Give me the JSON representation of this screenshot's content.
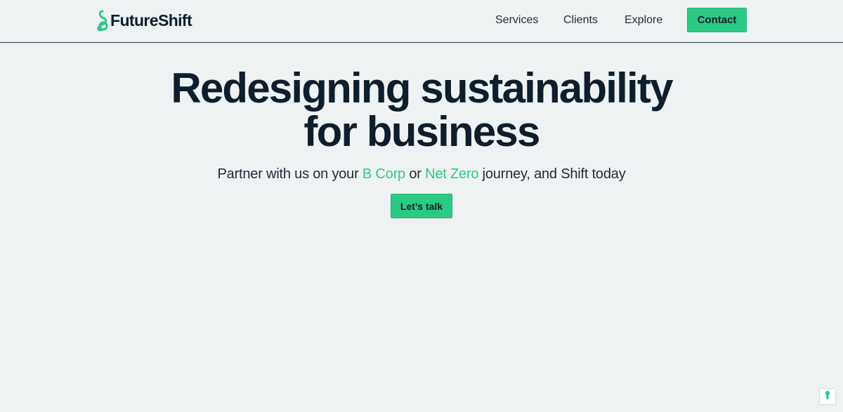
{
  "brand": {
    "name": "FutureShift",
    "accent_color": "#2cc985",
    "text_color": "#0e1e2c",
    "background_color": "#eff2f2"
  },
  "nav": {
    "items": [
      {
        "label": "Services"
      },
      {
        "label": "Clients"
      },
      {
        "label": "Explore"
      }
    ],
    "contact_label": "Contact"
  },
  "hero": {
    "title_line1": "Redesigning sustainability",
    "title_line2": "for business",
    "subtitle": {
      "part1": "Partner with us on your ",
      "accent1": "B Corp",
      "part2": " or ",
      "accent2": "Net Zero",
      "part3": " journey, and Shift today"
    },
    "cta_label": "Let’s talk"
  },
  "icons": {
    "logo_mark": "futureshift-logo-icon",
    "corner_widget": "cookie-settings-icon"
  }
}
